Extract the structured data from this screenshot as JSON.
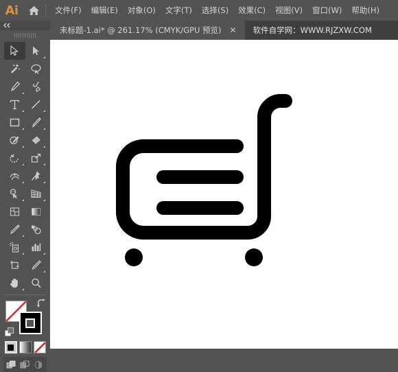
{
  "app": {
    "logo_text": "Ai",
    "home_icon": "home-icon"
  },
  "menubar": {
    "items": [
      {
        "label": "文件(F)",
        "name": "menu-file"
      },
      {
        "label": "编辑(E)",
        "name": "menu-edit"
      },
      {
        "label": "对象(O)",
        "name": "menu-object"
      },
      {
        "label": "文字(T)",
        "name": "menu-type"
      },
      {
        "label": "选择(S)",
        "name": "menu-select"
      },
      {
        "label": "效果(C)",
        "name": "menu-effect"
      },
      {
        "label": "视图(V)",
        "name": "menu-view"
      },
      {
        "label": "窗口(W)",
        "name": "menu-window"
      },
      {
        "label": "帮助(H)",
        "name": "menu-help"
      }
    ]
  },
  "tabbar": {
    "tab_title": "未标题-1.ai* @ 261.17% (CMYK/GPU 预览)",
    "close_label": "✕",
    "promo_text": "软件自学网：WWW.RJZXW.COM"
  },
  "toolbar": {
    "collapse_label": "◀◀",
    "tools": [
      {
        "name": "selection-tool",
        "label": "选择工具",
        "active": true,
        "corner": false
      },
      {
        "name": "direct-selection-tool",
        "label": "直接选择工具",
        "active": false,
        "corner": true
      },
      {
        "name": "magic-wand-tool",
        "label": "魔棒工具",
        "active": false,
        "corner": false
      },
      {
        "name": "lasso-tool",
        "label": "套索工具",
        "active": false,
        "corner": false
      },
      {
        "name": "pen-tool",
        "label": "钢笔工具",
        "active": false,
        "corner": true
      },
      {
        "name": "curvature-tool",
        "label": "曲率工具",
        "active": false,
        "corner": false
      },
      {
        "name": "type-tool",
        "label": "文字工具",
        "active": false,
        "corner": true
      },
      {
        "name": "line-segment-tool",
        "label": "直线段工具",
        "active": false,
        "corner": true
      },
      {
        "name": "rectangle-tool",
        "label": "矩形工具",
        "active": false,
        "corner": true
      },
      {
        "name": "paintbrush-tool",
        "label": "画笔工具",
        "active": false,
        "corner": true
      },
      {
        "name": "shaper-tool",
        "label": "Shaper 工具",
        "active": false,
        "corner": true
      },
      {
        "name": "eraser-tool",
        "label": "橡皮擦工具",
        "active": false,
        "corner": true
      },
      {
        "name": "rotate-tool",
        "label": "旋转工具",
        "active": false,
        "corner": true
      },
      {
        "name": "scale-tool",
        "label": "比例缩放工具",
        "active": false,
        "corner": true
      },
      {
        "name": "width-tool",
        "label": "宽度工具",
        "active": false,
        "corner": true
      },
      {
        "name": "free-transform-tool",
        "label": "自由变换工具",
        "active": false,
        "corner": true
      },
      {
        "name": "shape-builder-tool",
        "label": "形状生成器工具",
        "active": false,
        "corner": true
      },
      {
        "name": "perspective-grid-tool",
        "label": "透视网格工具",
        "active": false,
        "corner": true
      },
      {
        "name": "mesh-tool",
        "label": "网格工具",
        "active": false,
        "corner": false
      },
      {
        "name": "gradient-tool",
        "label": "渐变工具",
        "active": false,
        "corner": false
      },
      {
        "name": "eyedropper-tool",
        "label": "吸管工具",
        "active": false,
        "corner": true
      },
      {
        "name": "blend-tool",
        "label": "混合工具",
        "active": false,
        "corner": false
      },
      {
        "name": "symbol-sprayer-tool",
        "label": "符号喷枪工具",
        "active": false,
        "corner": true
      },
      {
        "name": "column-graph-tool",
        "label": "柱形图工具",
        "active": false,
        "corner": true
      },
      {
        "name": "artboard-tool",
        "label": "画板工具",
        "active": false,
        "corner": false
      },
      {
        "name": "slice-tool",
        "label": "切片工具",
        "active": false,
        "corner": true
      },
      {
        "name": "hand-tool",
        "label": "抓手工具",
        "active": false,
        "corner": true
      },
      {
        "name": "zoom-tool",
        "label": "缩放工具",
        "active": false,
        "corner": false
      }
    ],
    "fill_stroke": {
      "fill_label": "填色",
      "fill_color": "#ffffff",
      "fill_is_none": true,
      "stroke_label": "描边",
      "stroke_color": "#000000",
      "swap_label": "互换填色和描边",
      "default_label": "默认填色和描边"
    },
    "color_modes": [
      {
        "name": "color-mode-button",
        "label": "颜色",
        "selected": true
      },
      {
        "name": "gradient-mode-button",
        "label": "渐变",
        "selected": false
      },
      {
        "name": "none-mode-button",
        "label": "无",
        "selected": false
      }
    ],
    "draw_modes": [
      {
        "name": "draw-normal-button",
        "label": "正常绘图",
        "selected": true
      },
      {
        "name": "draw-behind-button",
        "label": "背面绘图",
        "selected": false
      },
      {
        "name": "draw-inside-button",
        "label": "内部绘图",
        "selected": false
      }
    ]
  },
  "canvas": {
    "artwork_name": "shopping-cart-icon",
    "artwork_color": "#000000",
    "background_color": "#ffffff",
    "zoom_level": "261.17%"
  },
  "colors": {
    "chrome": "#535353",
    "chrome_dark": "#3f3f3f",
    "accent": "#d9903f",
    "text": "#d4d4d4"
  }
}
